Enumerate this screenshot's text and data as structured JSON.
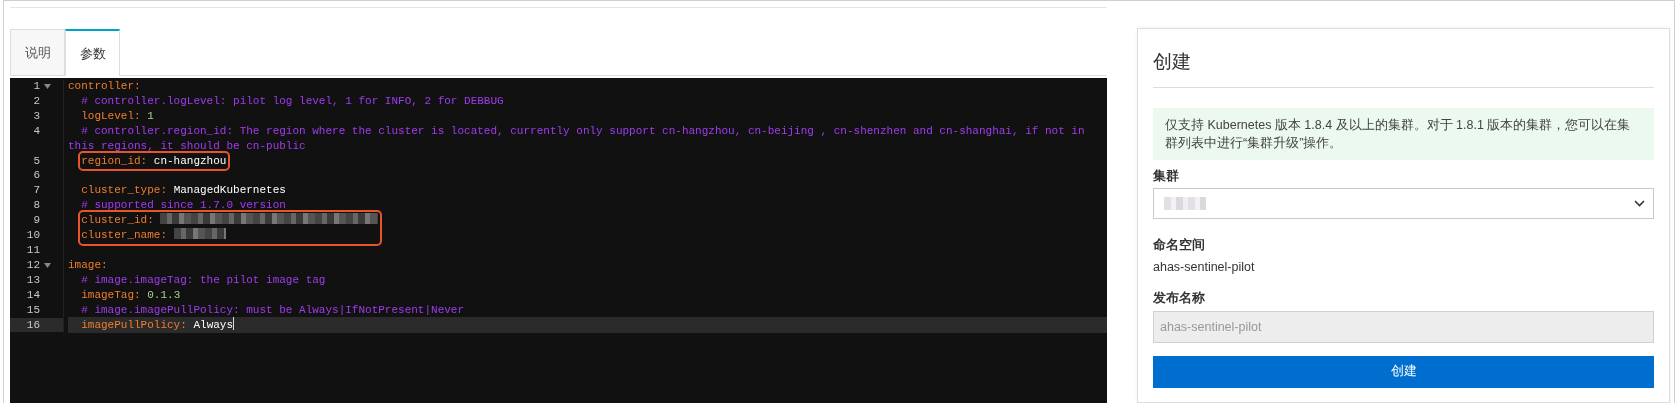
{
  "tabs": [
    {
      "label": "说明",
      "selected": false
    },
    {
      "label": "参数",
      "selected": true
    }
  ],
  "editor": {
    "blocks": [
      {
        "highlighted": false,
        "lines": [
          {
            "number": "1",
            "fold": true,
            "active": false,
            "tokens": [
              {
                "kind": "key",
                "text": "controller:"
              }
            ]
          },
          {
            "number": "2",
            "fold": false,
            "active": false,
            "tokens": [
              {
                "kind": "comment",
                "text": "  # controller.logLevel: pilot log level, 1 for INFO, 2 for DEBBUG"
              }
            ]
          },
          {
            "number": "3",
            "fold": false,
            "active": false,
            "tokens": [
              {
                "kind": "key",
                "text": "  logLevel:"
              },
              {
                "kind": "number",
                "text": " 1"
              }
            ]
          },
          {
            "number": "4",
            "fold": false,
            "active": false,
            "tokens": [
              {
                "kind": "comment",
                "text": "  # controller.region_id: The region where the cluster is located, currently only support cn-hangzhou, cn-beijing , cn-shenzhen and cn-shanghai, if not in this regions, it should be cn-public"
              }
            ]
          }
        ]
      },
      {
        "highlighted": true,
        "lines": [
          {
            "number": "5",
            "fold": false,
            "active": false,
            "tokens": [
              {
                "kind": "key",
                "text": "region_id:"
              },
              {
                "kind": "string",
                "text": " cn-hangzhou"
              }
            ]
          }
        ]
      },
      {
        "highlighted": false,
        "lines": [
          {
            "number": "6",
            "fold": false,
            "active": false
          },
          {
            "number": "7",
            "fold": false,
            "active": false,
            "tokens": [
              {
                "kind": "key",
                "text": "  cluster_type:"
              },
              {
                "kind": "string",
                "text": " ManagedKubernetes"
              }
            ]
          },
          {
            "number": "8",
            "fold": false,
            "active": false,
            "tokens": [
              {
                "kind": "comment",
                "text": "  # supported since 1.7.0 version"
              }
            ]
          }
        ]
      },
      {
        "highlighted": true,
        "lines": [
          {
            "number": "9",
            "fold": false,
            "active": false,
            "tokens": [
              {
                "kind": "key",
                "text": "cluster_id:"
              },
              {
                "kind": "redacted",
                "wide": true
              }
            ]
          },
          {
            "number": "10",
            "fold": false,
            "active": false,
            "tokens": [
              {
                "kind": "key",
                "text": "cluster_name:"
              },
              {
                "kind": "redacted",
                "wide": false
              }
            ]
          }
        ]
      },
      {
        "highlighted": false,
        "lines": [
          {
            "number": "11",
            "fold": false,
            "active": false
          },
          {
            "number": "12",
            "fold": true,
            "active": false,
            "tokens": [
              {
                "kind": "key",
                "text": "image:"
              }
            ]
          },
          {
            "number": "13",
            "fold": false,
            "active": false,
            "tokens": [
              {
                "kind": "comment",
                "text": "  # image.imageTag: the pilot image tag"
              }
            ]
          },
          {
            "number": "14",
            "fold": false,
            "active": false,
            "tokens": [
              {
                "kind": "key",
                "text": "  imageTag:"
              },
              {
                "kind": "number",
                "text": " 0.1.3"
              }
            ]
          },
          {
            "number": "15",
            "fold": false,
            "active": false,
            "tokens": [
              {
                "kind": "comment",
                "text": "  # image.imagePullPolicy: must be Always|IfNotPresent|Never"
              }
            ]
          },
          {
            "number": "16",
            "fold": false,
            "active": true,
            "tokens": [
              {
                "kind": "key",
                "text": "  imagePullPolicy:"
              },
              {
                "kind": "string",
                "text": " Always"
              }
            ]
          }
        ]
      }
    ]
  },
  "panel": {
    "title": "创建",
    "notice": "仅支持 Kubernetes 版本 1.8.4 及以上的集群。对于 1.8.1 版本的集群，您可以在集群列表中进行“集群升级”操作。",
    "cluster": {
      "label": "集群",
      "redacted": true
    },
    "namespace": {
      "label": "命名空间",
      "value": "ahas-sentinel-pilot"
    },
    "release_name": {
      "label": "发布名称",
      "value": "ahas-sentinel-pilot",
      "disabled": true
    },
    "submit": "创建"
  }
}
